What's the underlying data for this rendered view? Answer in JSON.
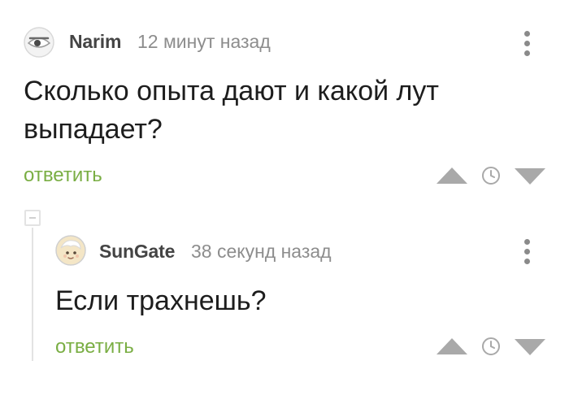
{
  "comments": [
    {
      "author": "Narim",
      "time": "12 минут назад",
      "text": "Сколько опыта дают и какой лут выпадает?",
      "reply_label": "ответить",
      "avatar_icon": "eye-avatar-icon"
    },
    {
      "author": "SunGate",
      "time": "38 секунд назад",
      "text": "Если трахнешь?",
      "reply_label": "ответить",
      "avatar_icon": "face-avatar-icon"
    }
  ],
  "colors": {
    "reply_link": "#7aae44",
    "vote_icons": "#a9a9a9",
    "time_text": "#8d8d8d"
  }
}
